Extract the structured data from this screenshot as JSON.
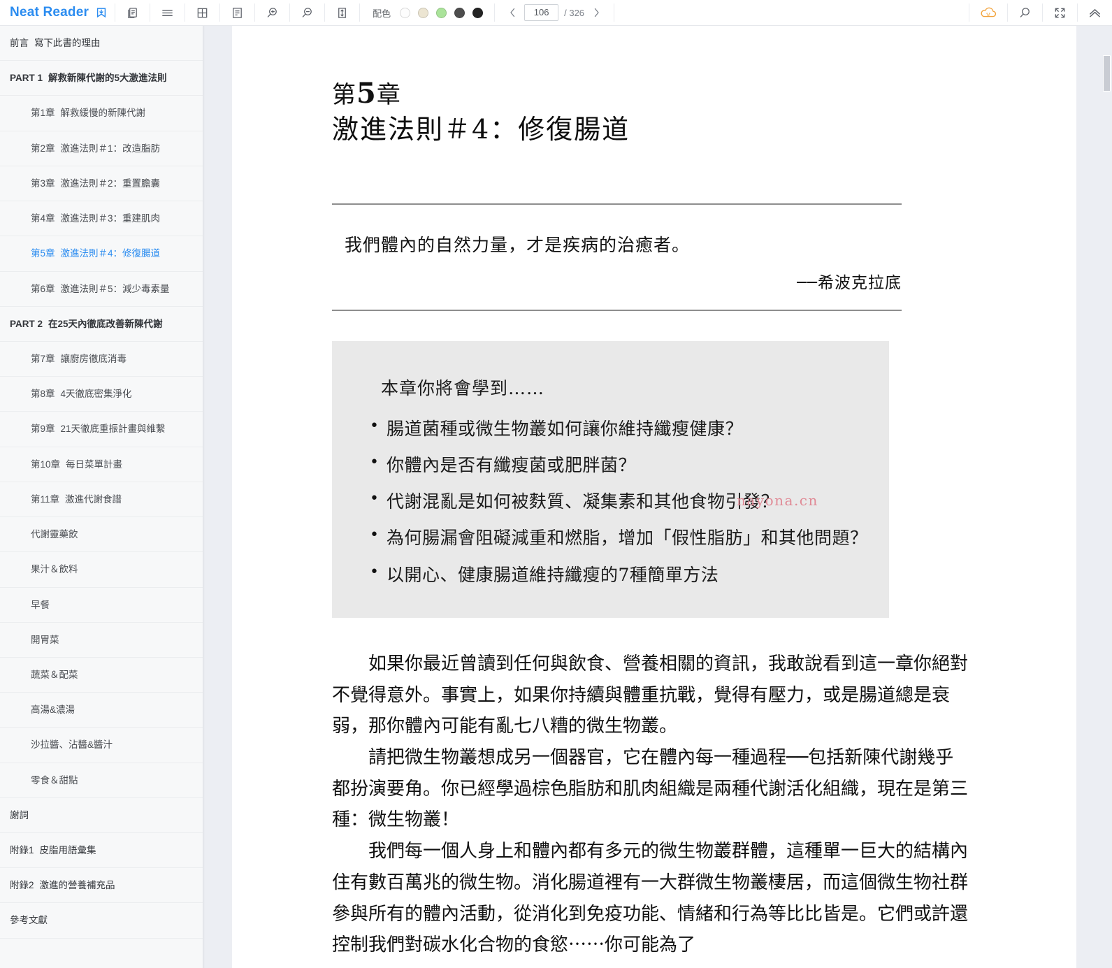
{
  "app": {
    "brand": "Neat Reader",
    "brand_color": "#2b8cf0",
    "brand_icon": "bookmark-save-icon"
  },
  "toolbar": {
    "buttons": [
      {
        "name": "copy-pages-icon",
        "label": "雙頁"
      },
      {
        "name": "list-view-icon",
        "label": "列表"
      },
      {
        "name": "grid-view-icon",
        "label": "網格"
      },
      {
        "name": "notes-icon",
        "label": "筆記"
      },
      {
        "name": "zoom-in-icon",
        "label": "放大"
      },
      {
        "name": "zoom-out-icon",
        "label": "縮小"
      },
      {
        "name": "line-height-icon",
        "label": "行距"
      }
    ],
    "color_scheme": {
      "label": "配色",
      "swatches": [
        "#fdfdfd",
        "#ece5d2",
        "#aae39a",
        "#4d4d4d",
        "#242424"
      ]
    },
    "pager": {
      "prev": "‹",
      "next": "›",
      "current_page": "106",
      "total_label": "/ 326",
      "total_pages": "326"
    },
    "right_buttons": [
      {
        "name": "cloud-sync-icon",
        "color": "#f2a33c"
      },
      {
        "name": "search-icon",
        "color": "#5c6068"
      },
      {
        "name": "fullscreen-icon",
        "color": "#5c6068"
      },
      {
        "name": "collapse-up-icon",
        "color": "#5c6068"
      }
    ]
  },
  "sidebar": {
    "items": [
      {
        "level": 1,
        "num": "前言",
        "label": "寫下此書的理由",
        "active": false,
        "bold": false
      },
      {
        "level": 1,
        "num": "PART 1",
        "label": "解救新陳代謝的5大激進法則",
        "active": false,
        "bold": true
      },
      {
        "level": 2,
        "num": "第1章",
        "label": "解救緩慢的新陳代謝",
        "active": false,
        "bold": false
      },
      {
        "level": 2,
        "num": "第2章",
        "label": "激進法則＃1：改造脂肪",
        "active": false,
        "bold": false
      },
      {
        "level": 2,
        "num": "第3章",
        "label": "激進法則＃2：重置膽囊",
        "active": false,
        "bold": false
      },
      {
        "level": 2,
        "num": "第4章",
        "label": "激進法則＃3：重建肌肉",
        "active": false,
        "bold": false
      },
      {
        "level": 2,
        "num": "第5章",
        "label": "激進法則＃4：修復腸道",
        "active": true,
        "bold": false
      },
      {
        "level": 2,
        "num": "第6章",
        "label": "激進法則＃5：減少毒素量",
        "active": false,
        "bold": false
      },
      {
        "level": 1,
        "num": "PART 2",
        "label": "在25天內徹底改善新陳代謝",
        "active": false,
        "bold": true
      },
      {
        "level": 2,
        "num": "第7章",
        "label": "讓廚房徹底消毒",
        "active": false,
        "bold": false
      },
      {
        "level": 2,
        "num": "第8章",
        "label": "4天徹底密集淨化",
        "active": false,
        "bold": false
      },
      {
        "level": 2,
        "num": "第9章",
        "label": "21天徹底重振計畫與維繫",
        "active": false,
        "bold": false
      },
      {
        "level": 2,
        "num": "第10章",
        "label": "每日菜單計畫",
        "active": false,
        "bold": false
      },
      {
        "level": 2,
        "num": "第11章",
        "label": "激進代謝食譜",
        "active": false,
        "bold": false
      },
      {
        "level": 2,
        "num": "",
        "label": "代謝靈藥飲",
        "active": false,
        "bold": false
      },
      {
        "level": 2,
        "num": "",
        "label": "果汁＆飲料",
        "active": false,
        "bold": false
      },
      {
        "level": 2,
        "num": "",
        "label": "早餐",
        "active": false,
        "bold": false
      },
      {
        "level": 2,
        "num": "",
        "label": "開胃菜",
        "active": false,
        "bold": false
      },
      {
        "level": 2,
        "num": "",
        "label": "蔬菜＆配菜",
        "active": false,
        "bold": false
      },
      {
        "level": 2,
        "num": "",
        "label": "高湯&濃湯",
        "active": false,
        "bold": false
      },
      {
        "level": 2,
        "num": "",
        "label": "沙拉醬、沾醬&醬汁",
        "active": false,
        "bold": false
      },
      {
        "level": 2,
        "num": "",
        "label": "零食＆甜點",
        "active": false,
        "bold": false
      },
      {
        "level": 1,
        "num": "",
        "label": "謝詞",
        "active": false,
        "bold": false
      },
      {
        "level": 1,
        "num": "附錄1",
        "label": "皮脂用語彙集",
        "active": false,
        "bold": false
      },
      {
        "level": 1,
        "num": "附錄2",
        "label": "激進的營養補充品",
        "active": false,
        "bold": false
      },
      {
        "level": 1,
        "num": "",
        "label": "參考文獻",
        "active": false,
        "bold": false
      }
    ]
  },
  "page": {
    "chapter_prefix": "第",
    "chapter_number": "5",
    "chapter_suffix": "章",
    "chapter_title": "激進法則＃4：修復腸道",
    "quote": "我們體內的自然力量，才是疾病的治癒者。",
    "quote_attribution": "──希波克拉底",
    "callout": {
      "lead": "本章你將會學到……",
      "bullets": [
        "腸道菌種或微生物叢如何讓你維持纖瘦健康？",
        "你體內是否有纖瘦菌或肥胖菌？",
        "代謝混亂是如何被麩質、凝集素和其他食物引發？",
        "為何腸漏會阻礙減重和燃脂，增加「假性脂肪」和其他問題？",
        "以開心、健康腸道維持纖瘦的7種簡單方法"
      ]
    },
    "paragraphs": [
      "如果你最近曾讀到任何與飲食、營養相關的資訊，我敢說看到這一章你絕對不覺得意外。事實上，如果你持續與體重抗戰，覺得有壓力，或是腸道總是衰弱，那你體內可能有亂七八糟的微生物叢。",
      "請把微生物叢想成另一個器官，它在體內每一種過程──包括新陳代謝幾乎都扮演要角。你已經學過棕色脂肪和肌肉組織是兩種代謝活化組織，現在是第三種：微生物叢！",
      "我們每一個人身上和體內都有多元的微生物叢群體，這種單一巨大的結構內住有數百萬兆的微生物。消化腸道裡有一大群微生物叢棲居，而這個微生物社群參與所有的體內活動，從消化到免疫功能、情緒和行為等比比皆是。它們或許還控制我們對碳水化合物的食慾⋯⋯你可能為了"
    ],
    "watermark": "nayona.cn"
  }
}
